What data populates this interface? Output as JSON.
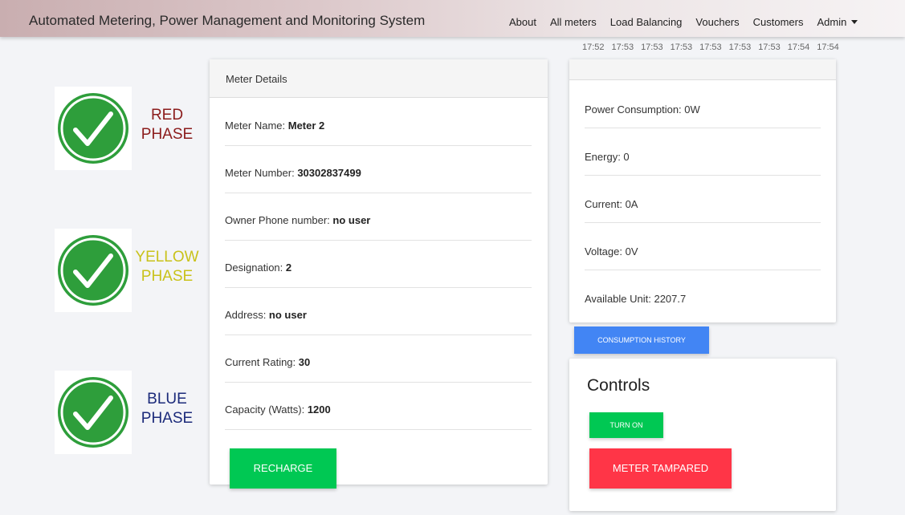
{
  "nav": {
    "brand": "Automated Metering, Power Management and Monitoring System",
    "links": [
      "About",
      "All meters",
      "Load Balancing",
      "Vouchers",
      "Customers"
    ],
    "admin": "Admin"
  },
  "time_ticks": [
    "17:52",
    "17:53",
    "17:53",
    "17:53",
    "17:53",
    "17:53",
    "17:53",
    "17:54",
    "17:54"
  ],
  "phases": {
    "red": {
      "line1": "RED",
      "line2": "PHASE",
      "color": "#8b1b1b",
      "status_icon": "check-circle-icon"
    },
    "yellow": {
      "line1": "YELLOW",
      "line2": "PHASE",
      "color": "#c9c21a",
      "status_icon": "check-circle-icon"
    },
    "blue": {
      "line1": "BLUE",
      "line2": "PHASE",
      "color": "#1b2a7a",
      "status_icon": "check-circle-icon"
    }
  },
  "meter_details": {
    "header": "Meter Details",
    "rows": [
      {
        "label": "Meter Name: ",
        "value": "Meter 2"
      },
      {
        "label": "Meter Number: ",
        "value": "30302837499"
      },
      {
        "label": "Owner Phone number: ",
        "value": "no user"
      },
      {
        "label": "Designation: ",
        "value": "2"
      },
      {
        "label": "Address: ",
        "value": "no user"
      },
      {
        "label": "Current Rating: ",
        "value": "30"
      },
      {
        "label": "Capacity (Watts): ",
        "value": "1200"
      }
    ],
    "recharge_label": "RECHARGE"
  },
  "readings": {
    "rows": [
      "Power Consumption: 0W",
      "Energy: 0",
      "Current: 0A",
      "Voltage: 0V",
      "Available Unit: 2207.7"
    ],
    "history_label": "CONSUMPTION HISTORY"
  },
  "controls": {
    "title": "Controls",
    "turn_on_label": "TURN ON",
    "tampered_label": "METER TAMPARED"
  },
  "colors": {
    "green_button": "#00c853",
    "blue_button": "#4285f4",
    "red_button": "#ff3547",
    "check_green": "#2e9e3b"
  }
}
